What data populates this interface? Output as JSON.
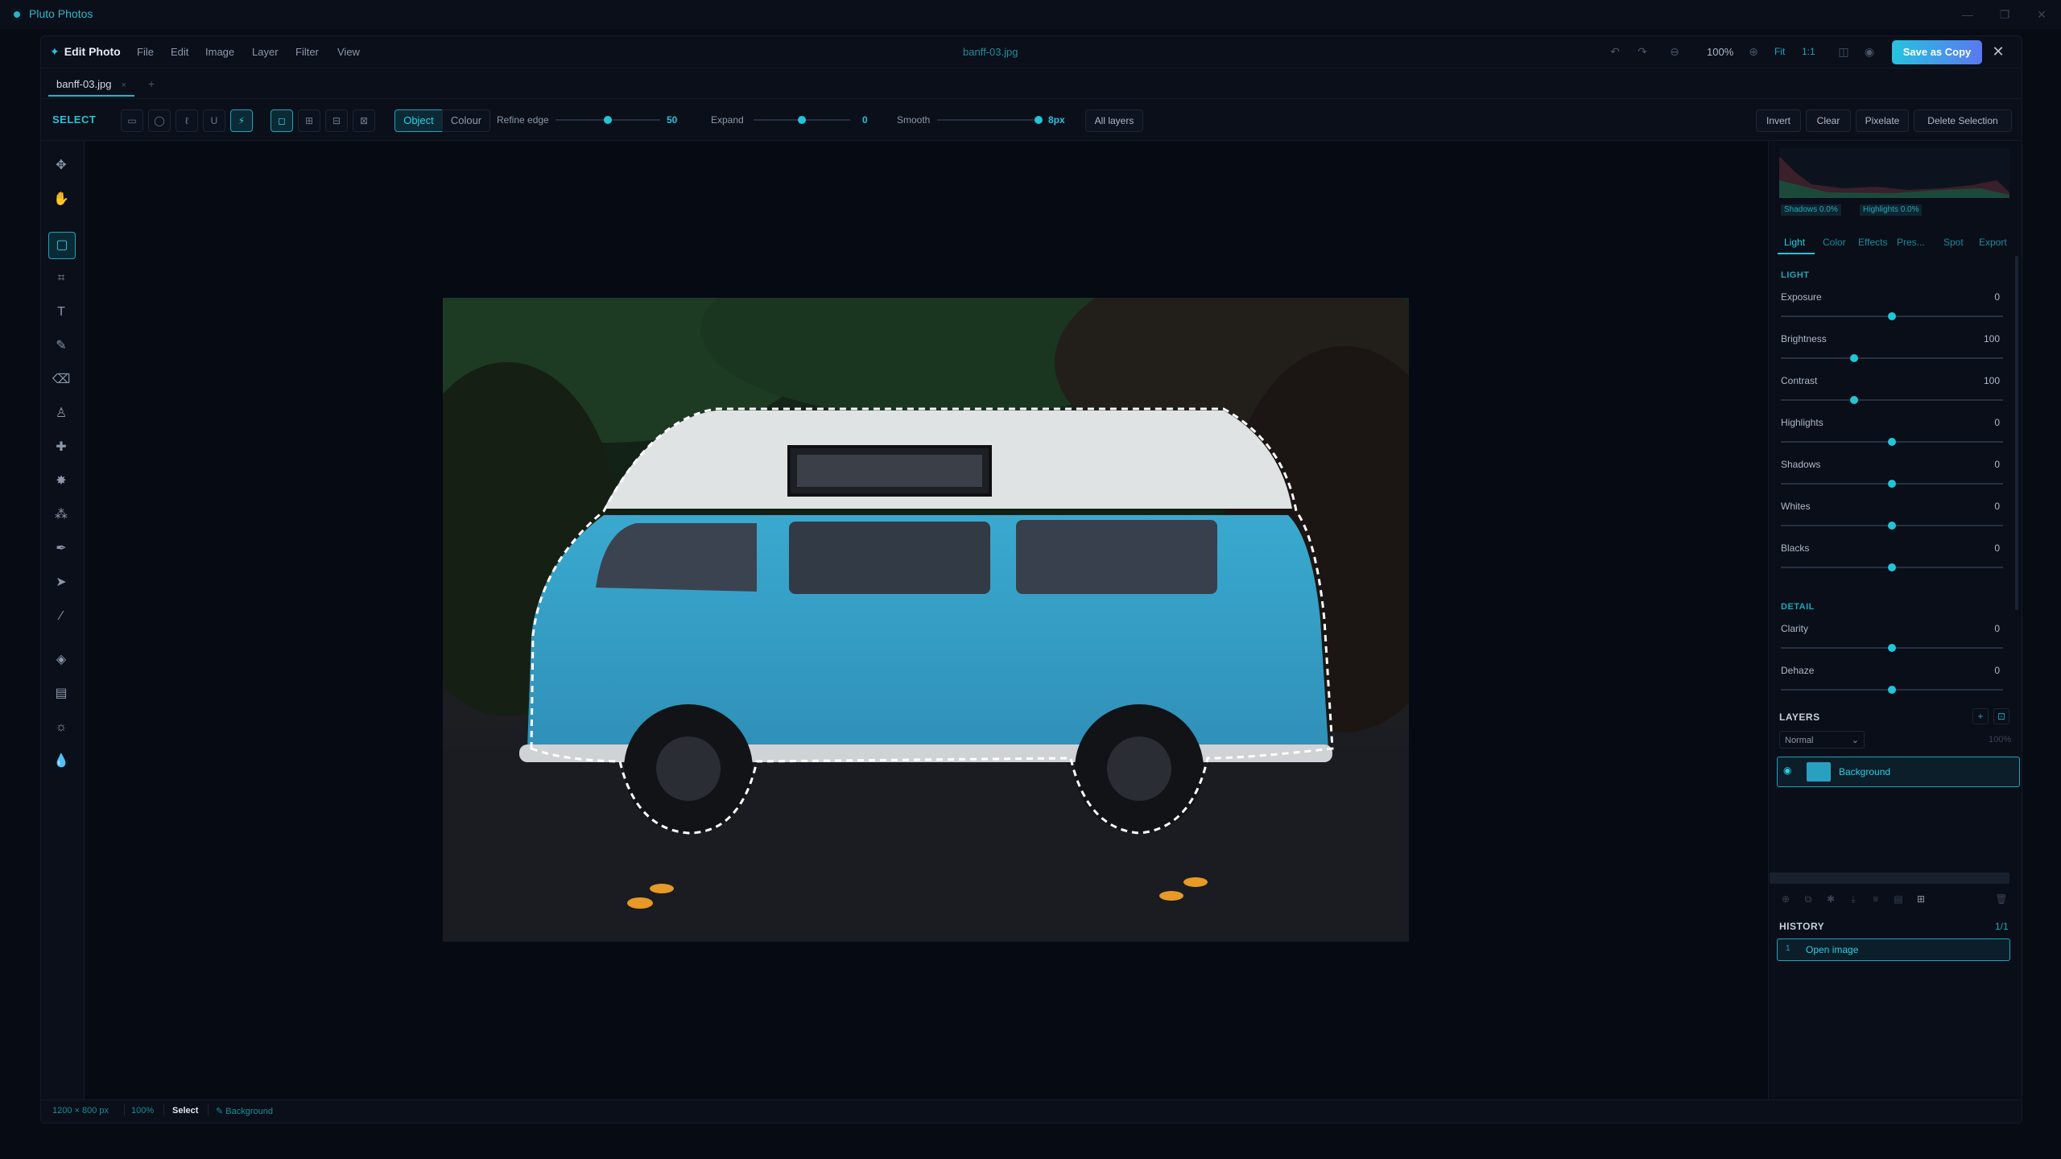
{
  "window": {
    "title": "Pluto Photos"
  },
  "menubar": {
    "brand": "Edit Photo",
    "menus": [
      "File",
      "Edit",
      "Image",
      "Layer",
      "Filter",
      "View"
    ],
    "filename": "banff-03.jpg",
    "zoom": "100%",
    "fit": "Fit",
    "one_to_one": "1:1",
    "save_label": "Save as Copy"
  },
  "tabs": [
    {
      "label": "banff-03.jpg"
    }
  ],
  "options": {
    "tool_label": "SELECT",
    "mode_object": "Object",
    "mode_colour": "Colour",
    "refine_label": "Refine edge",
    "refine_value": "50",
    "refine_fraction": 0.5,
    "expand_label": "Expand",
    "expand_value": "0",
    "expand_fraction": 0.5,
    "smooth_label": "Smooth",
    "smooth_value": "8px",
    "smooth_fraction": 1.0,
    "all_layers": "All layers",
    "invert": "Invert",
    "clear": "Clear",
    "pixelate": "Pixelate",
    "delete_selection": "Delete Selection"
  },
  "histogram": {
    "shadows": "Shadows 0.0%",
    "highlights": "Highlights 0.0%"
  },
  "panel_tabs": [
    "Light",
    "Color",
    "Effects",
    "Pres...",
    "Spot",
    "Export"
  ],
  "light": {
    "heading": "LIGHT",
    "items": [
      {
        "label": "Exposure",
        "value": "0",
        "fraction": 0.5
      },
      {
        "label": "Brightness",
        "value": "100",
        "fraction": 0.33
      },
      {
        "label": "Contrast",
        "value": "100",
        "fraction": 0.33
      },
      {
        "label": "Highlights",
        "value": "0",
        "fraction": 0.5
      },
      {
        "label": "Shadows",
        "value": "0",
        "fraction": 0.5
      },
      {
        "label": "Whites",
        "value": "0",
        "fraction": 0.5
      },
      {
        "label": "Blacks",
        "value": "0",
        "fraction": 0.5
      }
    ]
  },
  "detail": {
    "heading": "DETAIL",
    "items": [
      {
        "label": "Clarity",
        "value": "0",
        "fraction": 0.5
      },
      {
        "label": "Dehaze",
        "value": "0",
        "fraction": 0.5
      }
    ]
  },
  "layers": {
    "heading": "LAYERS",
    "blend": "Normal",
    "opacity": "100%",
    "items": [
      {
        "name": "Background"
      }
    ]
  },
  "history": {
    "heading": "HISTORY",
    "count": "1/1",
    "items": [
      {
        "num": "1",
        "name": "Open image"
      }
    ]
  },
  "status": {
    "size": "1200 × 800 px",
    "zoom": "100%",
    "tool": "Select",
    "layer": "✎ Background"
  },
  "colors": {
    "accent": "#22c5d8",
    "bg": "#070b14",
    "save_start": "#26c3e0",
    "save_end": "#5a78f0"
  }
}
